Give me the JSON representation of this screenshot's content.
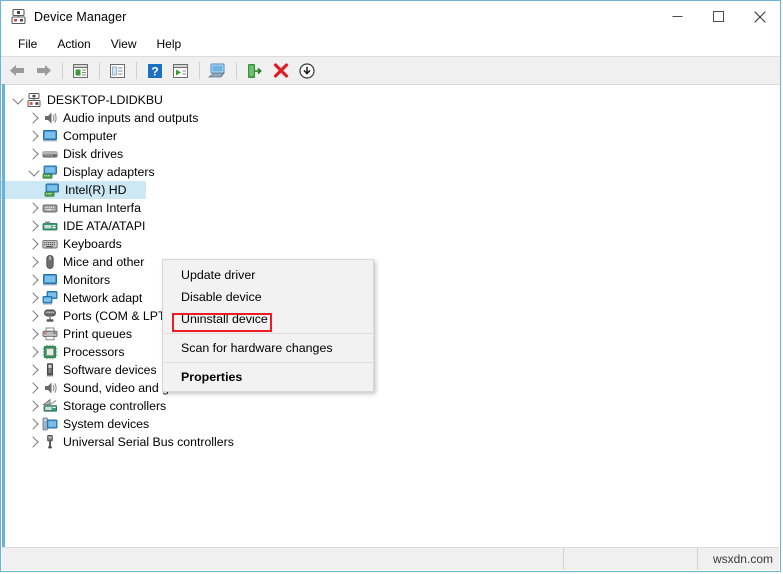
{
  "window": {
    "title": "Device Manager",
    "icon": "device-manager-icon",
    "controls": {
      "minimize": "minimize-icon",
      "maximize": "maximize-icon",
      "close": "close-icon"
    }
  },
  "menubar": {
    "items": [
      "File",
      "Action",
      "View",
      "Help"
    ]
  },
  "toolbar": {
    "buttons": [
      {
        "name": "back-icon"
      },
      {
        "name": "forward-icon"
      },
      {
        "sep": true
      },
      {
        "name": "properties-icon"
      },
      {
        "sep": true
      },
      {
        "name": "update-driver-icon"
      },
      {
        "sep": true
      },
      {
        "name": "help-icon"
      },
      {
        "name": "scan-hardware-icon"
      },
      {
        "sep": true
      },
      {
        "name": "show-hidden-devices-icon"
      },
      {
        "sep": true
      },
      {
        "name": "disable-device-icon"
      },
      {
        "name": "uninstall-device-icon"
      },
      {
        "name": "download-icon"
      }
    ]
  },
  "tree": {
    "root": {
      "label": "DESKTOP-LDIDKBU",
      "icon": "computer-root-icon",
      "expanded": true
    },
    "nodes": [
      {
        "label": "Audio inputs and outputs",
        "icon": "speaker-icon",
        "expanded": false,
        "level": 1
      },
      {
        "label": "Computer",
        "icon": "monitor-icon",
        "expanded": false,
        "level": 1
      },
      {
        "label": "Disk drives",
        "icon": "disk-drive-icon",
        "expanded": false,
        "level": 1
      },
      {
        "label": "Display adapters",
        "icon": "display-adapter-icon",
        "expanded": true,
        "level": 1
      },
      {
        "label": "Intel(R) HD",
        "icon": "display-adapter-icon",
        "expanded": null,
        "level": 2,
        "selected": true
      },
      {
        "label": "Human Interfa",
        "icon": "hid-icon",
        "expanded": false,
        "level": 1
      },
      {
        "label": "IDE ATA/ATAPI",
        "icon": "ide-controller-icon",
        "expanded": false,
        "level": 1
      },
      {
        "label": "Keyboards",
        "icon": "keyboard-icon",
        "expanded": false,
        "level": 1
      },
      {
        "label": "Mice and other",
        "icon": "mouse-icon",
        "expanded": false,
        "level": 1
      },
      {
        "label": "Monitors",
        "icon": "monitor-icon",
        "expanded": false,
        "level": 1
      },
      {
        "label": "Network adapt",
        "icon": "network-adapter-icon",
        "expanded": false,
        "level": 1
      },
      {
        "label": "Ports (COM & LPT)",
        "icon": "port-icon",
        "expanded": false,
        "level": 1
      },
      {
        "label": "Print queues",
        "icon": "printer-icon",
        "expanded": false,
        "level": 1
      },
      {
        "label": "Processors",
        "icon": "processor-icon",
        "expanded": false,
        "level": 1
      },
      {
        "label": "Software devices",
        "icon": "software-device-icon",
        "expanded": false,
        "level": 1
      },
      {
        "label": "Sound, video and game controllers",
        "icon": "speaker-icon",
        "expanded": false,
        "level": 1
      },
      {
        "label": "Storage controllers",
        "icon": "storage-controller-icon",
        "expanded": false,
        "level": 1
      },
      {
        "label": "System devices",
        "icon": "system-device-icon",
        "expanded": false,
        "level": 1
      },
      {
        "label": "Universal Serial Bus controllers",
        "icon": "usb-icon",
        "expanded": false,
        "level": 1
      }
    ]
  },
  "context_menu": {
    "items": [
      {
        "label": "Update driver",
        "bold": false
      },
      {
        "label": "Disable device",
        "bold": false
      },
      {
        "label": "Uninstall device",
        "bold": false,
        "highlighted": true
      },
      {
        "separator": true
      },
      {
        "label": "Scan for hardware changes",
        "bold": false
      },
      {
        "separator": true
      },
      {
        "label": "Properties",
        "bold": true
      }
    ],
    "highlight_color": "#ee1c25"
  },
  "statusbar": {
    "left": "",
    "middle": "",
    "right": "wsxdn.com"
  },
  "colors": {
    "window_border": "#6bb3d6",
    "selection": "#cce8f5",
    "toolbar_bg": "#f0f0f0",
    "menu_bg": "#f2f2f2"
  }
}
